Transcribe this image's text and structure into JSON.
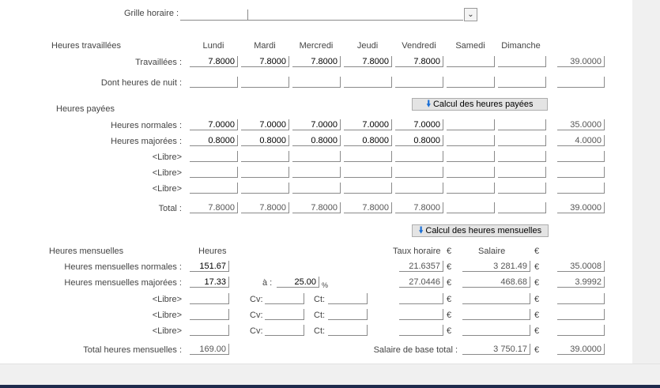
{
  "grille": {
    "label": "Grille horaire :",
    "value": ""
  },
  "days": [
    "Lundi",
    "Mardi",
    "Mercredi",
    "Jeudi",
    "Vendredi",
    "Samedi",
    "Dimanche"
  ],
  "travaillees": {
    "section": "Heures travaillées",
    "rows": [
      {
        "label": "Travaillées :",
        "values": [
          "7.8000",
          "7.8000",
          "7.8000",
          "7.8000",
          "7.8000",
          "",
          ""
        ],
        "total": "39.0000"
      },
      {
        "label": "Dont heures de nuit :",
        "values": [
          "",
          "",
          "",
          "",
          "",
          "",
          ""
        ],
        "total": ""
      }
    ]
  },
  "payees": {
    "section": "Heures payées",
    "button": "Calcul des heures payées",
    "rows": [
      {
        "label": "Heures normales :",
        "values": [
          "7.0000",
          "7.0000",
          "7.0000",
          "7.0000",
          "7.0000",
          "",
          ""
        ],
        "total": "35.0000"
      },
      {
        "label": "Heures majorées :",
        "values": [
          "0.8000",
          "0.8000",
          "0.8000",
          "0.8000",
          "0.8000",
          "",
          ""
        ],
        "total": "4.0000"
      },
      {
        "label": "<Libre>",
        "values": [
          "",
          "",
          "",
          "",
          "",
          "",
          ""
        ],
        "total": ""
      },
      {
        "label": "<Libre>",
        "values": [
          "",
          "",
          "",
          "",
          "",
          "",
          ""
        ],
        "total": ""
      },
      {
        "label": "<Libre>",
        "values": [
          "",
          "",
          "",
          "",
          "",
          "",
          ""
        ],
        "total": ""
      },
      {
        "label": "Total :",
        "values": [
          "7.8000",
          "7.8000",
          "7.8000",
          "7.8000",
          "7.8000",
          "",
          ""
        ],
        "total": "39.0000"
      }
    ]
  },
  "mensuelles": {
    "section": "Heures mensuelles",
    "button": "Calcul des heures mensuelles",
    "col_heures": "Heures",
    "col_taux": "Taux horaire",
    "col_salaire": "Salaire",
    "currency": "€",
    "a_label": "à :",
    "percent": "%",
    "cv_label": "Cv:",
    "ct_label": "Ct:",
    "normales": {
      "label": "Heures mensuelles normales :",
      "heures": "151.67",
      "taux": "21.6357",
      "salaire": "3 281.49",
      "total": "35.0008"
    },
    "majorees": {
      "label": "Heures mensuelles majorées :",
      "heures": "17.33",
      "a_value": "25.00",
      "taux": "27.0446",
      "salaire": "468.68",
      "total": "3.9992"
    },
    "libres": [
      {
        "label": "<Libre>"
      },
      {
        "label": "<Libre>"
      },
      {
        "label": "<Libre>"
      }
    ],
    "total_heures": {
      "label": "Total heures mensuelles :",
      "value": "169.00"
    },
    "salaire_base": {
      "label": "Salaire de base total :",
      "value": "3 750.17",
      "total": "39.0000"
    }
  }
}
